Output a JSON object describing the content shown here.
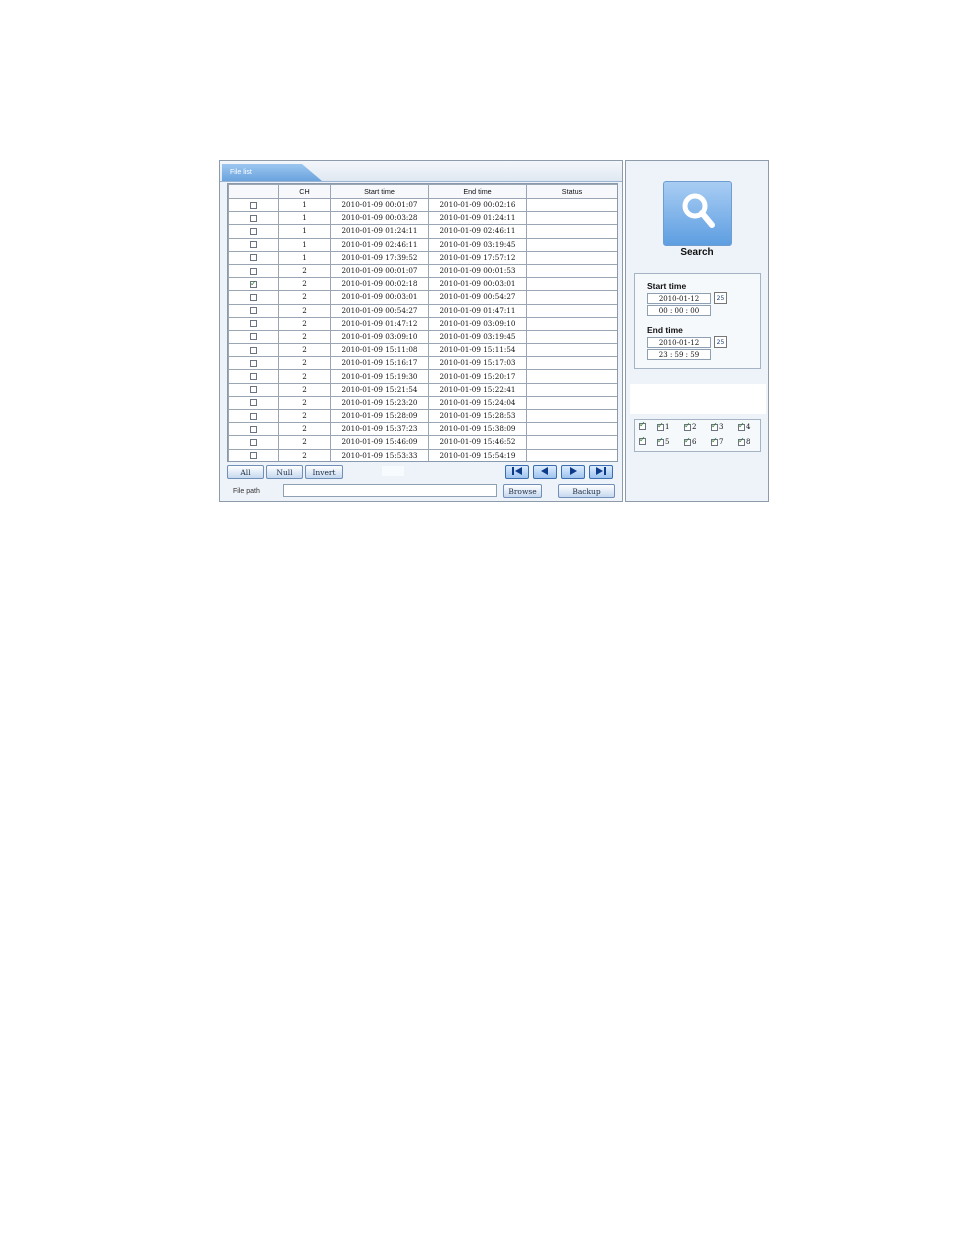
{
  "file_list": {
    "tab_label": "File list",
    "columns": [
      "",
      "CH",
      "Start time",
      "End time",
      "Status"
    ],
    "rows": [
      {
        "checked": false,
        "ch": "1",
        "start": "2010-01-09 00:01:07",
        "end": "2010-01-09 00:02:16",
        "status": ""
      },
      {
        "checked": false,
        "ch": "1",
        "start": "2010-01-09 00:03:28",
        "end": "2010-01-09 01:24:11",
        "status": ""
      },
      {
        "checked": false,
        "ch": "1",
        "start": "2010-01-09 01:24:11",
        "end": "2010-01-09 02:46:11",
        "status": ""
      },
      {
        "checked": false,
        "ch": "1",
        "start": "2010-01-09 02:46:11",
        "end": "2010-01-09 03:19:45",
        "status": ""
      },
      {
        "checked": false,
        "ch": "1",
        "start": "2010-01-09 17:39:52",
        "end": "2010-01-09 17:57:12",
        "status": ""
      },
      {
        "checked": false,
        "ch": "2",
        "start": "2010-01-09 00:01:07",
        "end": "2010-01-09 00:01:53",
        "status": ""
      },
      {
        "checked": true,
        "ch": "2",
        "start": "2010-01-09 00:02:18",
        "end": "2010-01-09 00:03:01",
        "status": ""
      },
      {
        "checked": false,
        "ch": "2",
        "start": "2010-01-09 00:03:01",
        "end": "2010-01-09 00:54:27",
        "status": ""
      },
      {
        "checked": false,
        "ch": "2",
        "start": "2010-01-09 00:54:27",
        "end": "2010-01-09 01:47:11",
        "status": ""
      },
      {
        "checked": false,
        "ch": "2",
        "start": "2010-01-09 01:47:12",
        "end": "2010-01-09 03:09:10",
        "status": ""
      },
      {
        "checked": false,
        "ch": "2",
        "start": "2010-01-09 03:09:10",
        "end": "2010-01-09 03:19:45",
        "status": ""
      },
      {
        "checked": false,
        "ch": "2",
        "start": "2010-01-09 15:11:08",
        "end": "2010-01-09 15:11:54",
        "status": ""
      },
      {
        "checked": false,
        "ch": "2",
        "start": "2010-01-09 15:16:17",
        "end": "2010-01-09 15:17:03",
        "status": ""
      },
      {
        "checked": false,
        "ch": "2",
        "start": "2010-01-09 15:19:30",
        "end": "2010-01-09 15:20:17",
        "status": ""
      },
      {
        "checked": false,
        "ch": "2",
        "start": "2010-01-09 15:21:54",
        "end": "2010-01-09 15:22:41",
        "status": ""
      },
      {
        "checked": false,
        "ch": "2",
        "start": "2010-01-09 15:23:20",
        "end": "2010-01-09 15:24:04",
        "status": ""
      },
      {
        "checked": false,
        "ch": "2",
        "start": "2010-01-09 15:28:09",
        "end": "2010-01-09 15:28:53",
        "status": ""
      },
      {
        "checked": false,
        "ch": "2",
        "start": "2010-01-09 15:37:23",
        "end": "2010-01-09 15:38:09",
        "status": ""
      },
      {
        "checked": false,
        "ch": "2",
        "start": "2010-01-09 15:46:09",
        "end": "2010-01-09 15:46:52",
        "status": ""
      },
      {
        "checked": false,
        "ch": "2",
        "start": "2010-01-09 15:53:33",
        "end": "2010-01-09 15:54:19",
        "status": ""
      }
    ]
  },
  "buttons": {
    "all": "All",
    "null": "Null",
    "invert": "Invert",
    "browse": "Browse",
    "backup": "Backup"
  },
  "navigation": {
    "first_icon": "first-page-icon",
    "prev_icon": "previous-page-icon",
    "next_icon": "next-page-icon",
    "last_icon": "last-page-icon"
  },
  "file_path": {
    "label": "File path",
    "value": ""
  },
  "search": {
    "label": "Search",
    "icon": "magnifier-icon"
  },
  "start_time": {
    "label": "Start time",
    "date": "2010-01-12",
    "hour": "00",
    "minute": "00",
    "second": "00",
    "calendar_text": "25"
  },
  "end_time": {
    "label": "End time",
    "date": "2010-01-12",
    "hour": "23",
    "minute": "59",
    "second": "59",
    "calendar_text": "25"
  },
  "channels": {
    "all_checked": true,
    "items": [
      {
        "label": "1",
        "checked": true
      },
      {
        "label": "2",
        "checked": true
      },
      {
        "label": "3",
        "checked": true
      },
      {
        "label": "4",
        "checked": true
      },
      {
        "label": "5",
        "checked": true
      },
      {
        "label": "6",
        "checked": true
      },
      {
        "label": "7",
        "checked": true
      },
      {
        "label": "8",
        "checked": true
      }
    ]
  },
  "colors": {
    "accent": "#6aa3dd",
    "panel_bg": "#eef3f9",
    "border": "#8d9bab"
  }
}
